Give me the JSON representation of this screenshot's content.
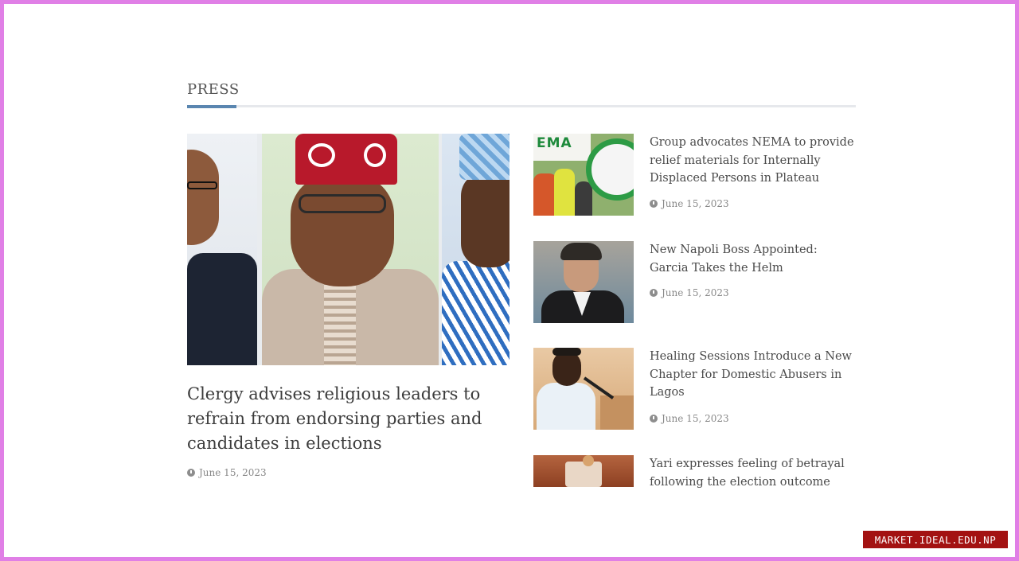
{
  "section": {
    "title": "PRESS"
  },
  "featured": {
    "headline": "Clergy advises religious leaders to refrain from endorsing parties and candidates in elections",
    "date": "June 15, 2023",
    "image_icon": "news-photo"
  },
  "side_articles": [
    {
      "title": "Group advocates NEMA to provide relief materials for Internally Displaced Persons in Plateau",
      "date": "June 15, 2023",
      "thumb_text": "EMA"
    },
    {
      "title": "New Napoli Boss Appointed: Garcia Takes the Helm",
      "date": "June 15, 2023"
    },
    {
      "title": "Healing Sessions Introduce a New Chapter for Domestic Abusers in Lagos",
      "date": "June 15, 2023"
    },
    {
      "title": "Yari expresses feeling of betrayal following the election outcome"
    }
  ],
  "watermark": "MARKET.IDEAL.EDU.NP",
  "colors": {
    "accent": "#5a86b0",
    "frame": "#e07fe6",
    "watermark_bg": "#a31212"
  }
}
